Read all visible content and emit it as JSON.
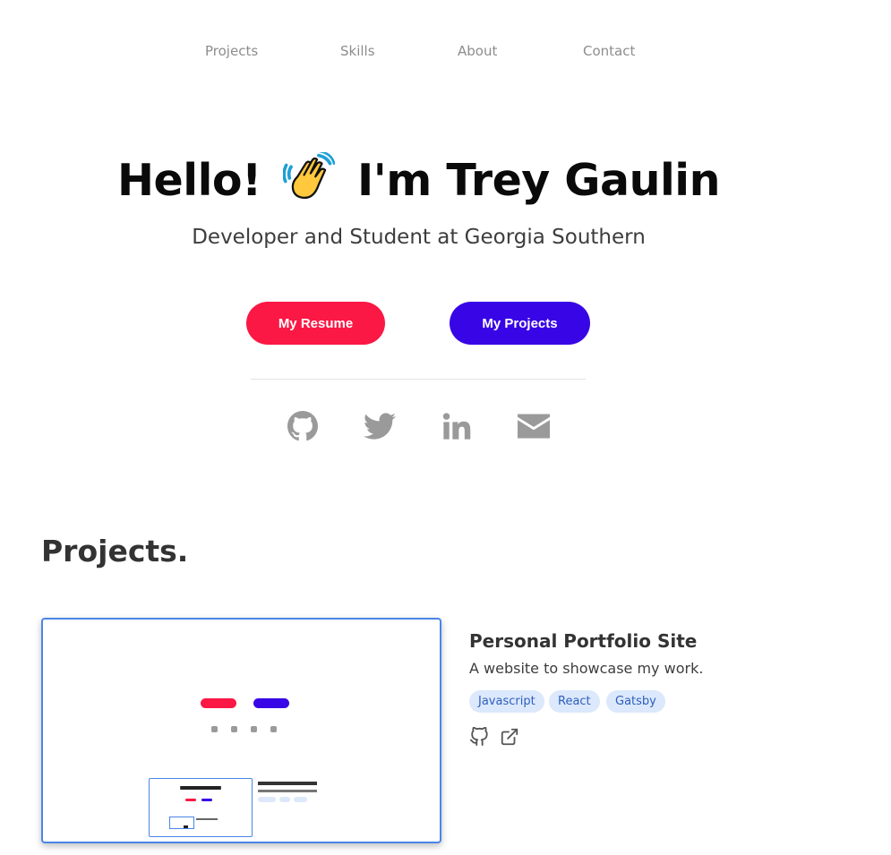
{
  "nav": {
    "items": [
      {
        "label": "Projects"
      },
      {
        "label": "Skills"
      },
      {
        "label": "About"
      },
      {
        "label": "Contact"
      }
    ]
  },
  "hero": {
    "title_part1": "Hello!",
    "title_part2": "I'm Trey Gaulin",
    "subtitle": "Developer and Student at Georgia Southern",
    "resume_button": "My Resume",
    "projects_button": "My Projects"
  },
  "social": {
    "icons": [
      "github-icon",
      "twitter-icon",
      "linkedin-icon",
      "email-icon"
    ]
  },
  "projects": {
    "heading": "Projects.",
    "items": [
      {
        "title": "Personal Portfolio Site",
        "description": "A website to showcase my work.",
        "tags": [
          "Javascript",
          "React",
          "Gatsby"
        ]
      }
    ]
  },
  "colors": {
    "resume_button": "#fb1844",
    "projects_button": "#3805e6",
    "tag_background": "#dce8fb",
    "tag_text": "#2d5fbf",
    "screenshot_border": "#4a86e8"
  }
}
